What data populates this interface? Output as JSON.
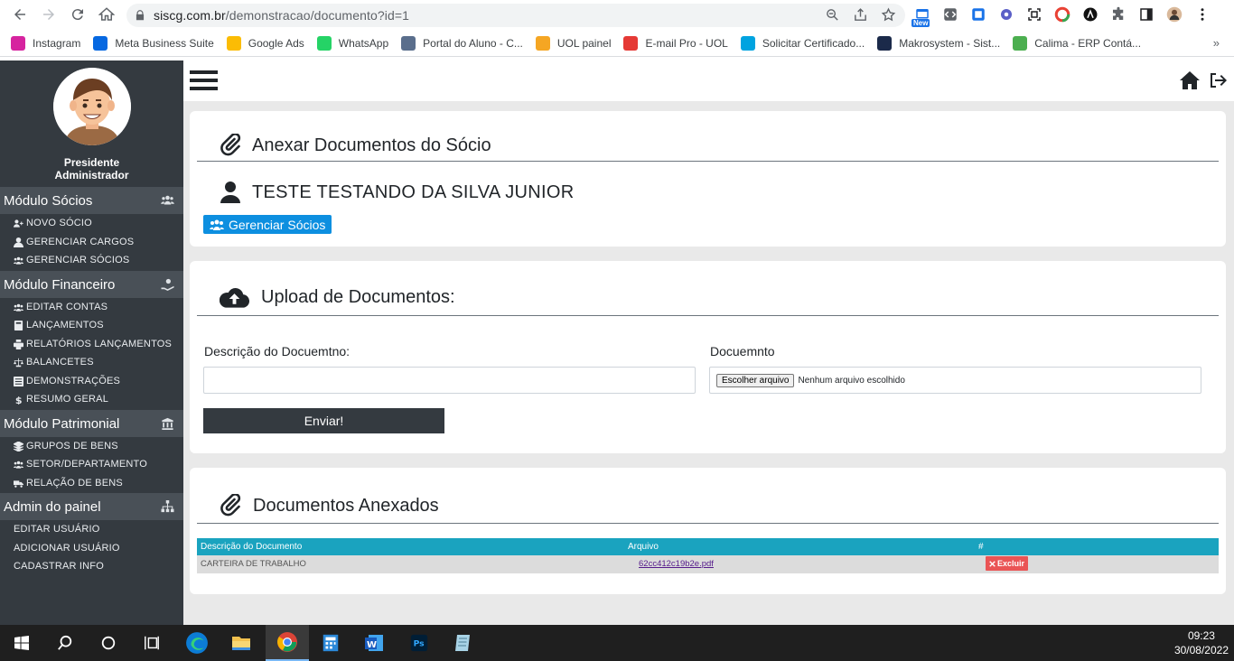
{
  "browser": {
    "url_host": "siscg.com.br",
    "url_path": "/demonstracao/documento?id=1",
    "new_badge": "New",
    "bookmarks": [
      {
        "label": "Instagram",
        "icon": "instagram-icon",
        "color": "#d6249f"
      },
      {
        "label": "Meta Business Suite",
        "icon": "meta-icon",
        "color": "#0668e1"
      },
      {
        "label": "Google Ads",
        "icon": "google-ads-icon",
        "color": "#fbbc04"
      },
      {
        "label": "WhatsApp",
        "icon": "whatsapp-icon",
        "color": "#25d366"
      },
      {
        "label": "Portal do Aluno - C...",
        "icon": "portal-icon",
        "color": "#5a6e8c"
      },
      {
        "label": "UOL painel",
        "icon": "uol-icon",
        "color": "#f5a623"
      },
      {
        "label": "E-mail Pro - UOL",
        "icon": "email-pro-icon",
        "color": "#e53935"
      },
      {
        "label": "Solicitar Certificado...",
        "icon": "certificado-icon",
        "color": "#00a3e0"
      },
      {
        "label": "Makrosystem - Sist...",
        "icon": "makrosystem-icon",
        "color": "#1b2a4a"
      },
      {
        "label": "Calima - ERP Contá...",
        "icon": "calima-icon",
        "color": "#4caf50"
      }
    ],
    "more_label": "»"
  },
  "sidebar": {
    "user_role": "Presidente",
    "user_name": "Administrador",
    "modules": [
      {
        "title": "Módulo Sócios",
        "icon": "users-icon",
        "items": [
          "NOVO SÓCIO",
          "GERENCIAR CARGOS",
          "GERENCIAR SÓCIOS"
        ]
      },
      {
        "title": "Módulo Financeiro",
        "icon": "hand-coin-icon",
        "items": [
          "EDITAR CONTAS",
          "LANÇAMENTOS",
          "RELATÓRIOS LANÇAMENTOS",
          "BALANCETES",
          "DEMONSTRAÇÕES",
          "RESUMO GERAL"
        ]
      },
      {
        "title": "Módulo Patrimonial",
        "icon": "bank-icon",
        "items": [
          "GRUPOS DE BENS",
          "SETOR/DEPARTAMENTO",
          "RELAÇÃO DE BENS"
        ]
      },
      {
        "title": "Admin do painel",
        "icon": "sitemap-icon",
        "items": [
          "EDITAR USUÁRIO",
          "ADICIONAR USUÁRIO",
          "CADASTRAR INFO"
        ]
      }
    ]
  },
  "main": {
    "section_attach": {
      "title": "Anexar Documentos do Sócio",
      "member_name": "TESTE TESTANDO DA SILVA JUNIOR",
      "manage_button": "Gerenciar Sócios"
    },
    "section_upload": {
      "title": "Upload de Documentos:",
      "description_label": "Descrição do Docuemtno:",
      "description_value": "",
      "document_label": "Docuemnto",
      "file_button": "Escolher arquivo",
      "file_status": "Nenhum arquivo escolhido",
      "submit": "Enviar!"
    },
    "section_attached": {
      "title": "Documentos Anexados",
      "columns": [
        "Descrição do Documento",
        "Arquivo",
        "#"
      ],
      "rows": [
        {
          "description": "CARTEIRA DE TRABALHO",
          "file": "62cc412c19b2e.pdf",
          "action": "Excluir"
        }
      ]
    }
  },
  "taskbar": {
    "time": "09:23",
    "date": "30/08/2022"
  }
}
